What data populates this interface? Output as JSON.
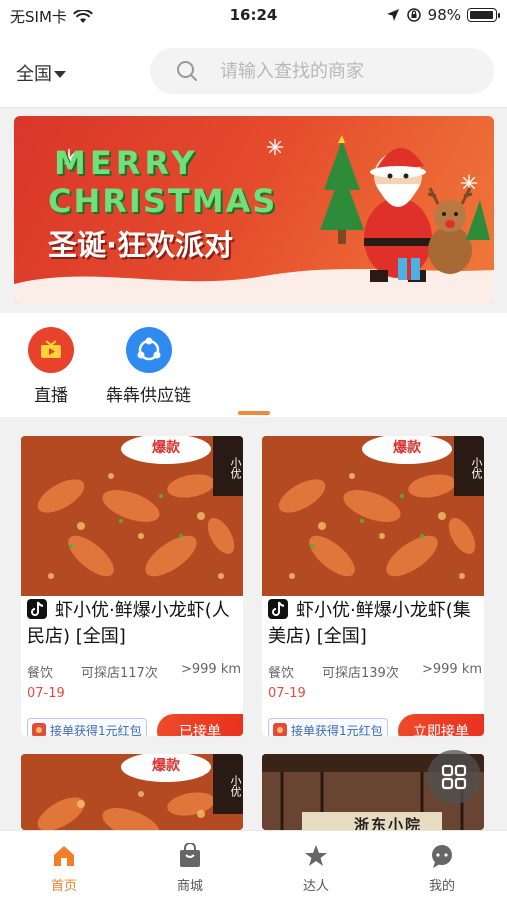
{
  "status_bar": {
    "carrier": "无SIM卡",
    "time": "16:24",
    "battery": "98%"
  },
  "header": {
    "region": "全国",
    "search_placeholder": "请输入查找的商家"
  },
  "banner": {
    "line1": "MERRY",
    "line2": "CHRISTMAS",
    "line3": "圣诞·狂欢派对"
  },
  "categories": [
    {
      "label": "直播",
      "icon": "tv-icon",
      "color": "#e8412c"
    },
    {
      "label": "犇犇供应链",
      "icon": "network-icon",
      "color": "#2f8bf0"
    }
  ],
  "cards": [
    {
      "title": "虾小优·鲜爆小龙虾(人民店) [全国]",
      "category": "餐饮",
      "visits": "可探店117次",
      "distance": ">999 km",
      "date": "07-19",
      "promo": "接单获得1元红包",
      "action": "已接单",
      "badge": "爆款",
      "strip": "小优"
    },
    {
      "title": "虾小优·鲜爆小龙虾(集美店) [全国]",
      "category": "餐饮",
      "visits": "可探店139次",
      "distance": ">999 km",
      "date": "07-19",
      "promo": "接单获得1元红包",
      "action": "立即接单",
      "badge": "爆款",
      "strip": "小优"
    },
    {
      "badge": "爆款",
      "strip": "小优"
    },
    {
      "sign": "浙东小院"
    }
  ],
  "tabbar": [
    {
      "label": "首页",
      "icon": "home-icon",
      "active": true
    },
    {
      "label": "商城",
      "icon": "shopping-bag-icon",
      "active": false
    },
    {
      "label": "达人",
      "icon": "star-icon",
      "active": false
    },
    {
      "label": "我的",
      "icon": "chat-bubble-icon",
      "active": false
    }
  ],
  "colors": {
    "accent": "#f07f2a",
    "cta_red": "#e8321f",
    "live_red": "#e8412c",
    "supply_blue": "#2f8bf0"
  }
}
